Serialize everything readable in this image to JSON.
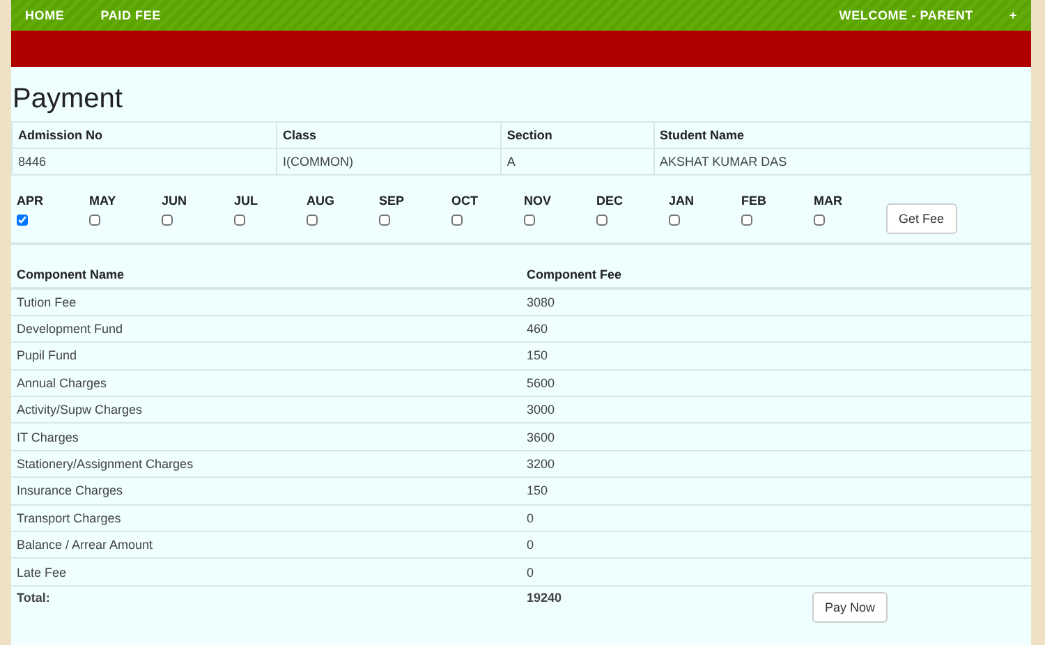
{
  "nav": {
    "links": [
      "HOME",
      "PAID FEE"
    ],
    "welcome": "WELCOME - PARENT",
    "toggle": "+"
  },
  "title": "Payment",
  "student": {
    "columns": [
      "Admission No",
      "Class",
      "Section",
      "Student Name"
    ],
    "values": [
      "8446",
      "I(COMMON)",
      "A",
      "AKSHAT KUMAR DAS"
    ]
  },
  "months": [
    {
      "label": "APR",
      "checked": true
    },
    {
      "label": "MAY",
      "checked": false
    },
    {
      "label": "JUN",
      "checked": false
    },
    {
      "label": "JUL",
      "checked": false
    },
    {
      "label": "AUG",
      "checked": false
    },
    {
      "label": "SEP",
      "checked": false
    },
    {
      "label": "OCT",
      "checked": false
    },
    {
      "label": "NOV",
      "checked": false
    },
    {
      "label": "DEC",
      "checked": false
    },
    {
      "label": "JAN",
      "checked": false
    },
    {
      "label": "FEB",
      "checked": false
    },
    {
      "label": "MAR",
      "checked": false
    }
  ],
  "get_fee_button": "Get Fee",
  "components": {
    "columns": [
      "Component Name",
      "Component Fee"
    ],
    "rows": [
      {
        "name": "Tution Fee",
        "fee": "3080"
      },
      {
        "name": "Development Fund",
        "fee": "460"
      },
      {
        "name": "Pupil Fund",
        "fee": "150"
      },
      {
        "name": "Annual Charges",
        "fee": "5600"
      },
      {
        "name": "Activity/Supw Charges",
        "fee": "3000"
      },
      {
        "name": "IT Charges",
        "fee": "3600"
      },
      {
        "name": "Stationery/Assignment Charges",
        "fee": "3200"
      },
      {
        "name": "Insurance Charges",
        "fee": "150"
      },
      {
        "name": "Transport Charges",
        "fee": "0"
      },
      {
        "name": "Balance / Arrear Amount",
        "fee": "0"
      },
      {
        "name": "Late Fee",
        "fee": "0"
      }
    ],
    "total_label": "Total:",
    "total": "19240"
  },
  "pay_button": "Pay Now"
}
